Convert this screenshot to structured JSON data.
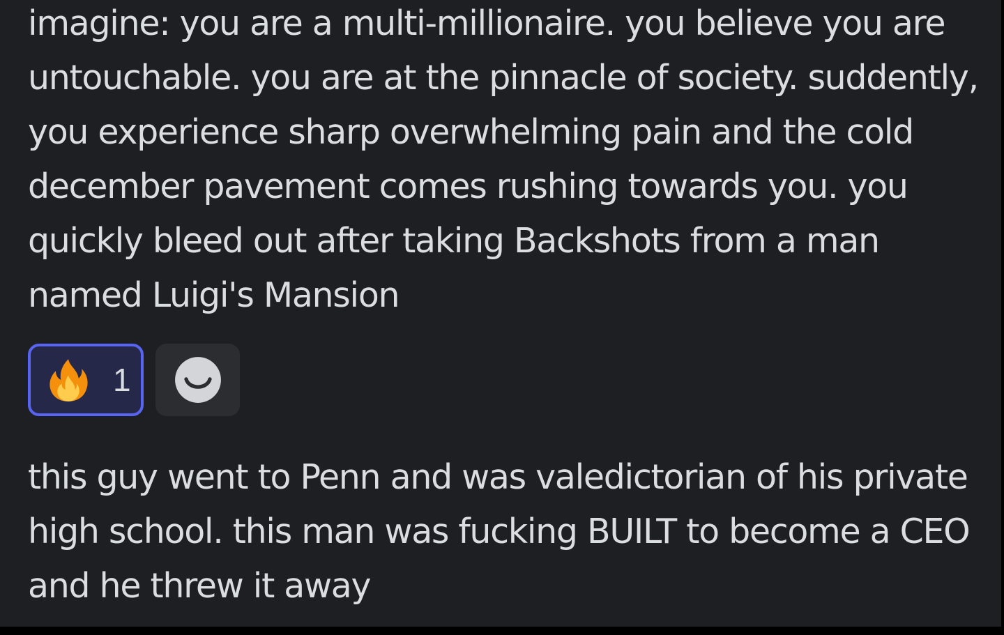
{
  "messages": [
    {
      "text": "imagine: you are a multi-millionaire. you believe you are untouchable. you are at the pinnacle of society. suddently, you experience sharp overwhelming pain and the cold december pavement comes rushing towards you. you quickly bleed out after taking Backshots from a man named Luigi's Mansion",
      "reactions": [
        {
          "emoji": "fire-icon",
          "count": "1",
          "selected": true
        }
      ],
      "add_reaction_icon": "smile-icon"
    },
    {
      "text": "this guy went to Penn and was valedictorian of his private high school. this man was fucking BUILT to become a CEO and he threw it away"
    }
  ],
  "colors": {
    "background": "#1e1f22",
    "text": "#dbdee1",
    "reaction_selected_bg": "#26284a",
    "reaction_selected_border": "#5865f2",
    "add_reaction_bg": "#2b2d31"
  }
}
